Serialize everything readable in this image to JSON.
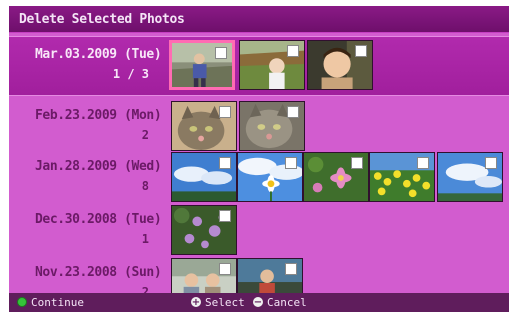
{
  "title": "Delete Selected Photos",
  "rows": [
    {
      "date": "Mar.03.2009 (Tue)",
      "count": "1 / 3",
      "thumbs": [
        "child-blue-jacket",
        "child-field",
        "child-portrait"
      ]
    },
    {
      "date": "Feb.23.2009 (Mon)",
      "count": "2",
      "thumbs": [
        "cat-1",
        "cat-2"
      ]
    },
    {
      "date": "Jan.28.2009 (Wed)",
      "count": "8",
      "thumbs": [
        "sky-clouds",
        "white-flower",
        "pink-flowers",
        "yellow-flowers",
        "sky-clouds-2"
      ]
    },
    {
      "date": "Dec.30.2008 (Tue)",
      "count": "1",
      "thumbs": [
        "purple-flowers"
      ]
    },
    {
      "date": "Nov.23.2008 (Sun)",
      "count": "2",
      "thumbs": [
        "two-kids",
        "child-bench"
      ]
    }
  ],
  "bottom_bar": {
    "continue_label": "Continue",
    "select_label": "Select",
    "cancel_label": "Cancel"
  },
  "colors": {
    "background": "#d25ccf",
    "selected_row": "#a11f9d",
    "title_bar": "#7a1576",
    "cursor": "#ff6bb3"
  },
  "icons": {
    "continue": "green-button-icon",
    "select": "plus-button-icon",
    "cancel": "minus-button-icon"
  }
}
